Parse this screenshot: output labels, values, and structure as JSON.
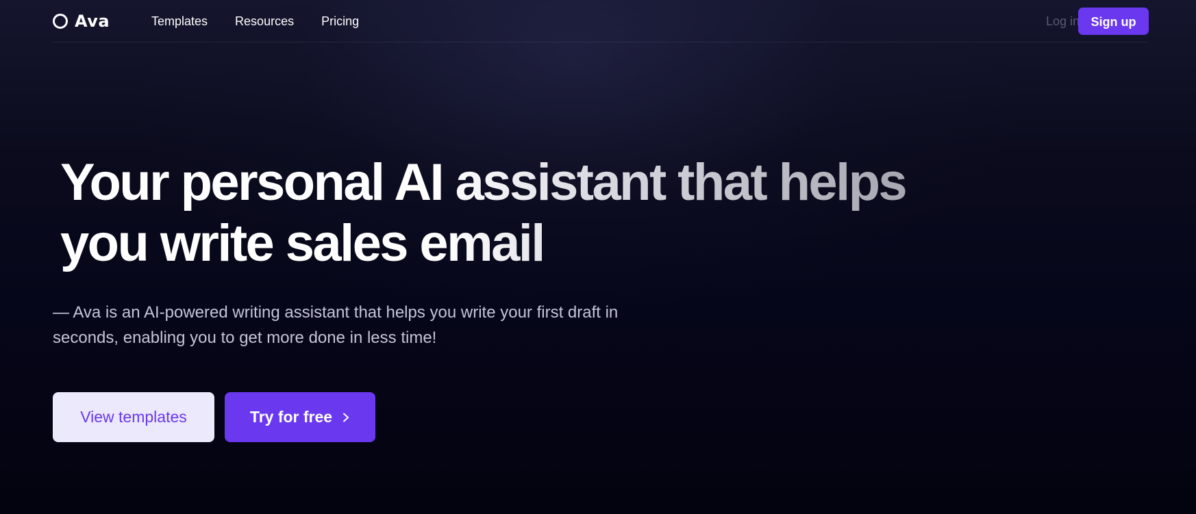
{
  "header": {
    "brand": "Ava",
    "nav": [
      "Templates",
      "Resources",
      "Pricing"
    ],
    "login_label": "Log in",
    "signup_label": "Sign up"
  },
  "hero": {
    "title_line1": "Your personal AI assistant that helps",
    "title_line2": "you write sales email",
    "subtitle": "— Ava is an AI-powered writing assistant that helps you write your first draft in seconds, enabling you to get more done in less time!",
    "view_templates_label": "View templates",
    "try_free_label": "Try for free"
  },
  "icons": {
    "brand": "ring-logo-icon",
    "cta": "chevron-right-icon"
  },
  "colors": {
    "accent": "#6a38ef",
    "accent_light": "#ece9fd",
    "background": "#06061a"
  }
}
